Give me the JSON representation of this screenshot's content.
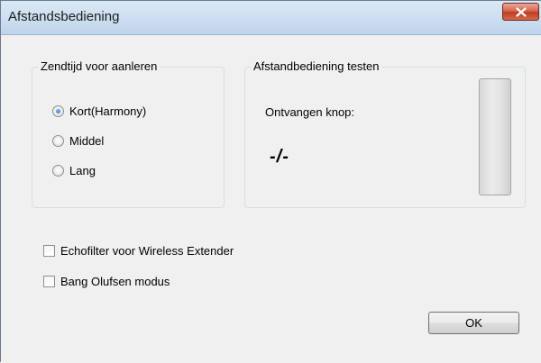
{
  "window": {
    "title": "Afstandsbediening",
    "close_icon": "close-icon",
    "close_color": "#c8432b"
  },
  "send_time_group": {
    "legend": "Zendtijd voor aanleren",
    "options": [
      {
        "label": "Kort(Harmony)",
        "checked": true
      },
      {
        "label": "Middel",
        "checked": false
      },
      {
        "label": "Lang",
        "checked": false
      }
    ]
  },
  "test_group": {
    "legend": "Afstandbediening testen",
    "received_label": "Ontvangen knop:",
    "received_value": "-/-"
  },
  "options": {
    "echofilter": {
      "label": "Echofilter voor Wireless Extender",
      "checked": false
    },
    "bang_olufsen": {
      "label": "Bang Olufsen modus",
      "checked": false
    }
  },
  "buttons": {
    "ok_label": "OK"
  }
}
